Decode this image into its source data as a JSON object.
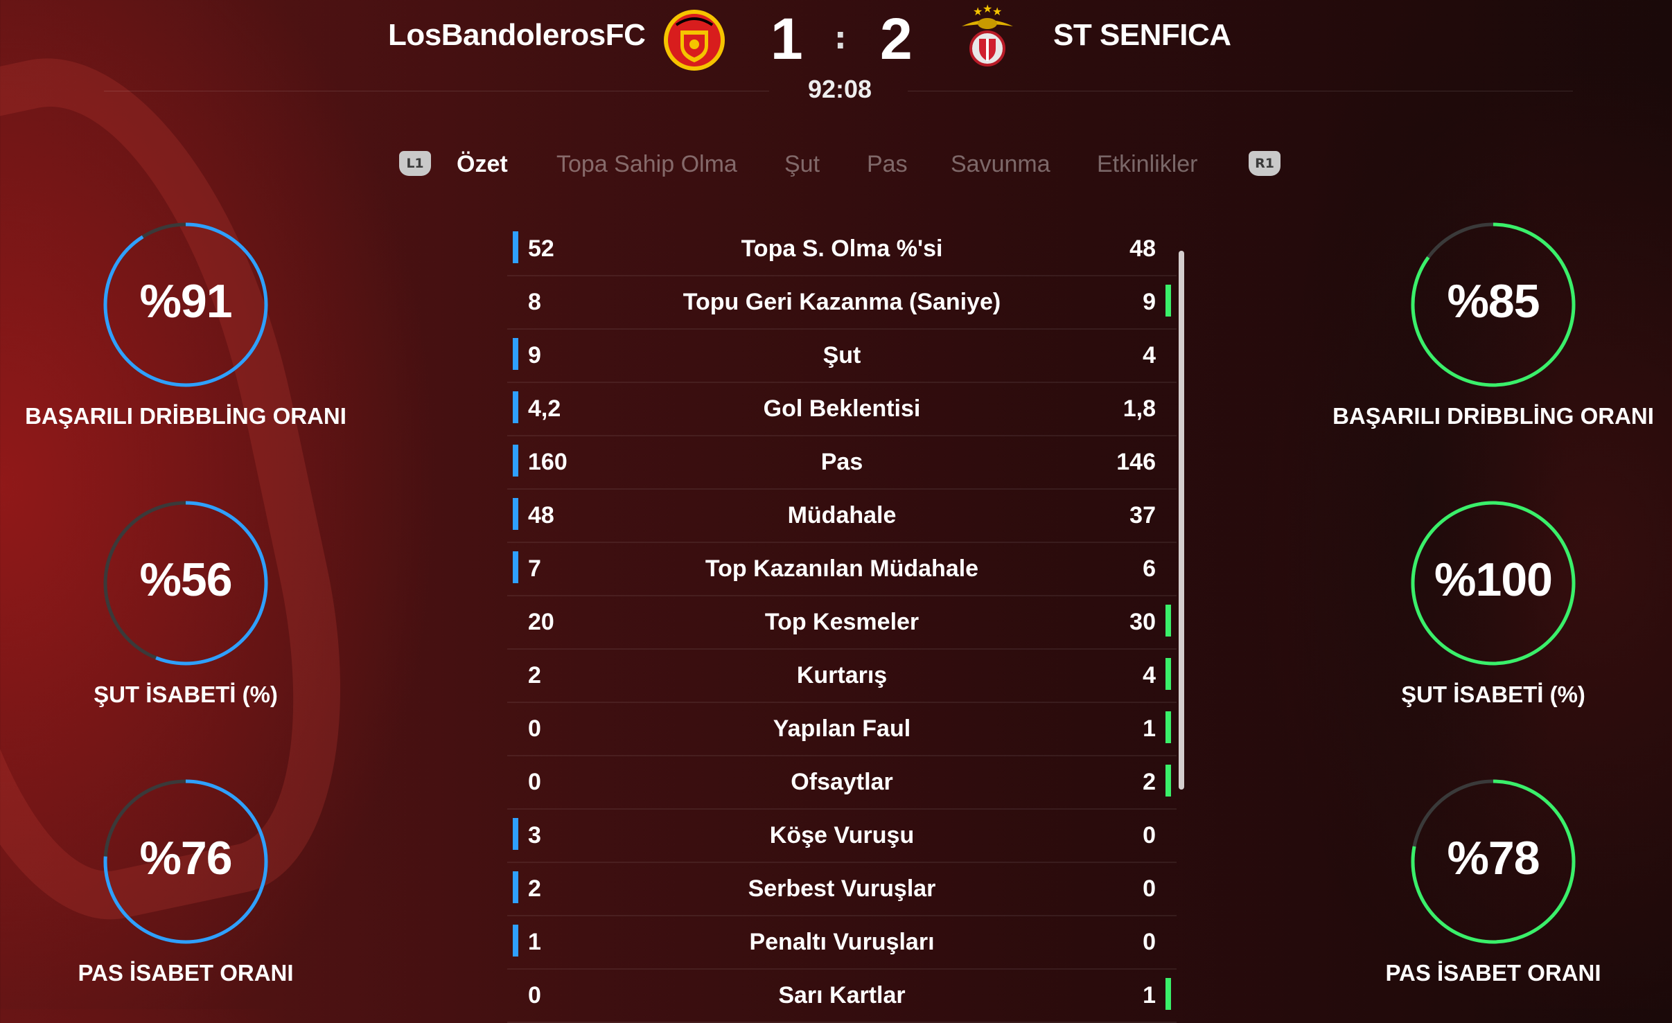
{
  "colors": {
    "home": "#2fa0ff",
    "away": "#3af06a",
    "ring_track": "#3a3a3a"
  },
  "header": {
    "home_team": "LosBandolerosFC",
    "away_team": "ST SENFICA",
    "home_score": "1",
    "separator": ":",
    "away_score": "2",
    "clock": "92:08",
    "home_crest_icon": "manchester-united-crest",
    "away_crest_icon": "benfica-crest"
  },
  "tabs": {
    "left_bumper": "L1",
    "right_bumper": "R1",
    "items": [
      "Özet",
      "Topa Sahip Olma",
      "Şut",
      "Pas",
      "Savunma",
      "Etkinlikler"
    ],
    "active": 0
  },
  "home_rings": [
    {
      "value": "%91",
      "percent": 91,
      "label": "BAŞARILI DRİBBLİNG ORANI"
    },
    {
      "value": "%56",
      "percent": 56,
      "label": "ŞUT İSABETİ (%)"
    },
    {
      "value": "%76",
      "percent": 76,
      "label": "PAS İSABET ORANI"
    }
  ],
  "away_rings": [
    {
      "value": "%85",
      "percent": 85,
      "label": "BAŞARILI DRİBBLİNG ORANI"
    },
    {
      "value": "%100",
      "percent": 100,
      "label": "ŞUT İSABETİ (%)"
    },
    {
      "value": "%78",
      "percent": 78,
      "label": "PAS İSABET ORANI"
    }
  ],
  "stats": [
    {
      "label": "Topa S. Olma %'si",
      "home": "52",
      "away": "48",
      "lead": "home"
    },
    {
      "label": "Topu Geri Kazanma (Saniye)",
      "home": "8",
      "away": "9",
      "lead": "away"
    },
    {
      "label": "Şut",
      "home": "9",
      "away": "4",
      "lead": "home"
    },
    {
      "label": "Gol Beklentisi",
      "home": "4,2",
      "away": "1,8",
      "lead": "home"
    },
    {
      "label": "Pas",
      "home": "160",
      "away": "146",
      "lead": "home"
    },
    {
      "label": "Müdahale",
      "home": "48",
      "away": "37",
      "lead": "home"
    },
    {
      "label": "Top Kazanılan Müdahale",
      "home": "7",
      "away": "6",
      "lead": "home"
    },
    {
      "label": "Top Kesmeler",
      "home": "20",
      "away": "30",
      "lead": "away"
    },
    {
      "label": "Kurtarış",
      "home": "2",
      "away": "4",
      "lead": "away"
    },
    {
      "label": "Yapılan Faul",
      "home": "0",
      "away": "1",
      "lead": "away"
    },
    {
      "label": "Ofsaytlar",
      "home": "0",
      "away": "2",
      "lead": "away"
    },
    {
      "label": "Köşe Vuruşu",
      "home": "3",
      "away": "0",
      "lead": "home"
    },
    {
      "label": "Serbest Vuruşlar",
      "home": "2",
      "away": "0",
      "lead": "home"
    },
    {
      "label": "Penaltı Vuruşları",
      "home": "1",
      "away": "0",
      "lead": "home"
    },
    {
      "label": "Sarı Kartlar",
      "home": "0",
      "away": "1",
      "lead": "away"
    }
  ]
}
